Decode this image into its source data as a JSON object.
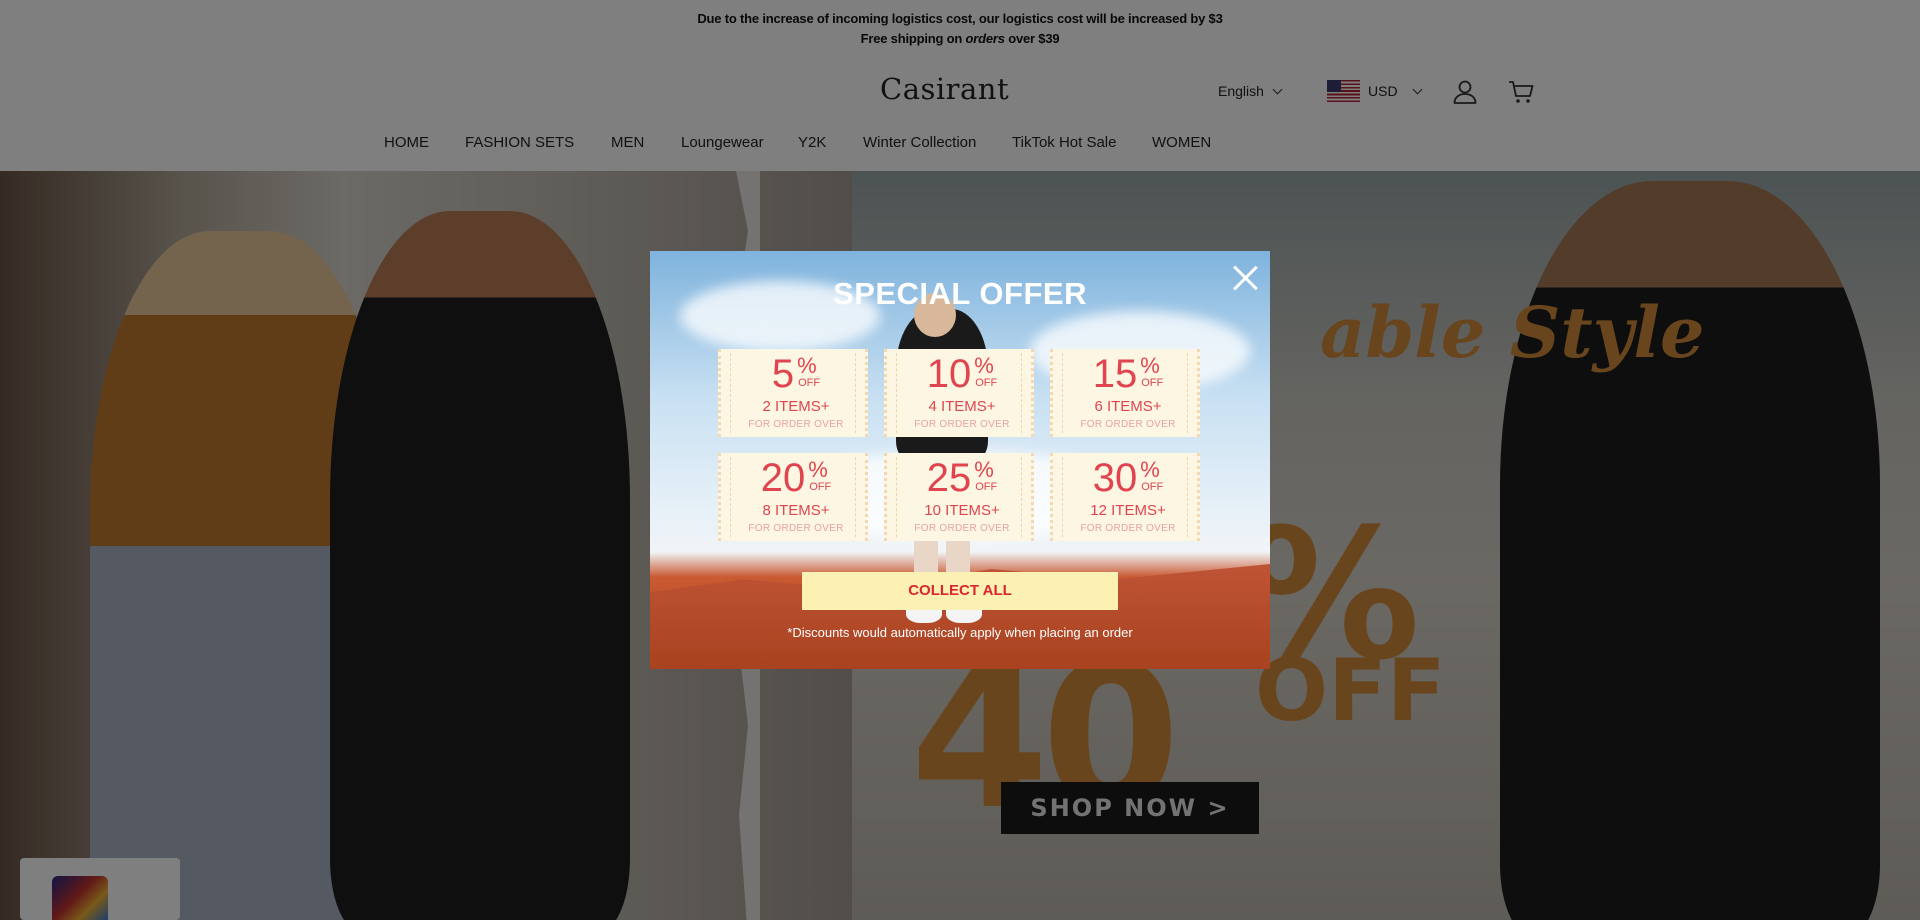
{
  "announcement": {
    "line1": "Due to the increase of incoming logistics cost, our logistics cost will be increased by $3",
    "line2_before": "Free shipping on ",
    "line2_em": "orders",
    "line2_after": " over $39"
  },
  "header": {
    "logo": "Casirant",
    "language": "English",
    "currency": "USD"
  },
  "nav": [
    "HOME",
    "FASHION SETS",
    "MEN",
    "Loungewear",
    "Y2K",
    "Winter Collection",
    "TikTok Hot Sale",
    "WOMEN"
  ],
  "hero": {
    "script_text": "able Style",
    "big_text": "%",
    "off_text": "OFF",
    "number_text": "40",
    "cta": "SHOP NOW >",
    "accent_color": "#d08a3a"
  },
  "modal": {
    "title": "SPECIAL OFFER",
    "coupons": [
      {
        "value": "5",
        "percent": "%",
        "off": "OFF",
        "items": "2 ITEMS+",
        "footer": "FOR ORDER OVER"
      },
      {
        "value": "10",
        "percent": "%",
        "off": "OFF",
        "items": "4 ITEMS+",
        "footer": "FOR ORDER OVER"
      },
      {
        "value": "15",
        "percent": "%",
        "off": "OFF",
        "items": "6 ITEMS+",
        "footer": "FOR ORDER OVER"
      },
      {
        "value": "20",
        "percent": "%",
        "off": "OFF",
        "items": "8 ITEMS+",
        "footer": "FOR ORDER OVER"
      },
      {
        "value": "25",
        "percent": "%",
        "off": "OFF",
        "items": "10 ITEMS+",
        "footer": "FOR ORDER OVER"
      },
      {
        "value": "30",
        "percent": "%",
        "off": "OFF",
        "items": "12 ITEMS+",
        "footer": "FOR ORDER OVER"
      }
    ],
    "collect_label": "COLLECT ALL",
    "disclaimer": "*Discounts would automatically apply when placing an order",
    "coupon_text_color": "#e0454f",
    "collect_bg": "#fdf0b3"
  },
  "icons": {
    "account": "user-icon",
    "cart": "cart-icon",
    "close": "close-icon"
  }
}
